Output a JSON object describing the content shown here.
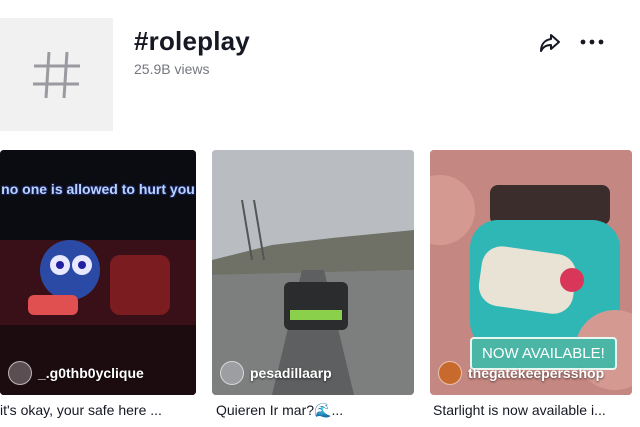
{
  "hashtag": {
    "title": "#roleplay",
    "views": "25.9B views"
  },
  "actions": {
    "share_icon": "share-icon",
    "more_icon": "more-icon"
  },
  "videos": [
    {
      "overlay": "no one is allowed to hurt you",
      "author": "_.g0thb0yclique",
      "caption": "it's okay, your safe here ..."
    },
    {
      "author": "pesadillaarp",
      "caption": "Quieren Ir mar?🌊..."
    },
    {
      "banner": "NOW AVAILABLE!",
      "author": "thegatekeepersshop",
      "caption": "Starlight is now available i..."
    }
  ],
  "colors": {
    "text": "#161823",
    "muted": "#75777f",
    "tile_bg": "#f1f1f2"
  }
}
